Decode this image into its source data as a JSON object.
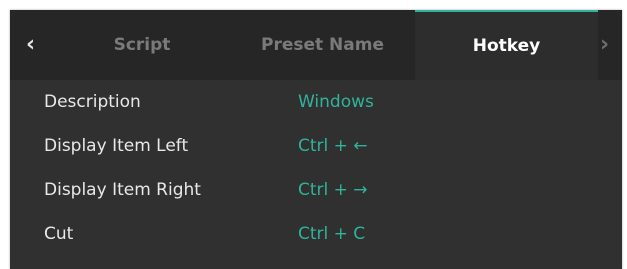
{
  "tabbar": {
    "prev_arrow": "‹",
    "next_arrow": "›",
    "tabs": [
      {
        "label": "Script",
        "active": false
      },
      {
        "label": "Preset Name",
        "active": false
      },
      {
        "label": "Hotkey",
        "active": true
      }
    ]
  },
  "hotkeys": {
    "header": {
      "name": "Description",
      "key": "Windows"
    },
    "rows": [
      {
        "name": "Display Item Left",
        "key": "Ctrl + ←"
      },
      {
        "name": "Display Item Right",
        "key": "Ctrl + →"
      },
      {
        "name": "Cut",
        "key": "Ctrl + C"
      }
    ]
  },
  "colors": {
    "accent": "#2fb39b",
    "panel_bg": "#303030",
    "tabbar_bg": "#262626",
    "active_tab_bg": "#2d2d2d",
    "inactive_tab_text": "#7a7a7a",
    "row_text": "#e8e8e8"
  },
  "icons": {
    "prev_arrow": "chevron-left-icon",
    "next_arrow": "chevron-right-icon"
  }
}
